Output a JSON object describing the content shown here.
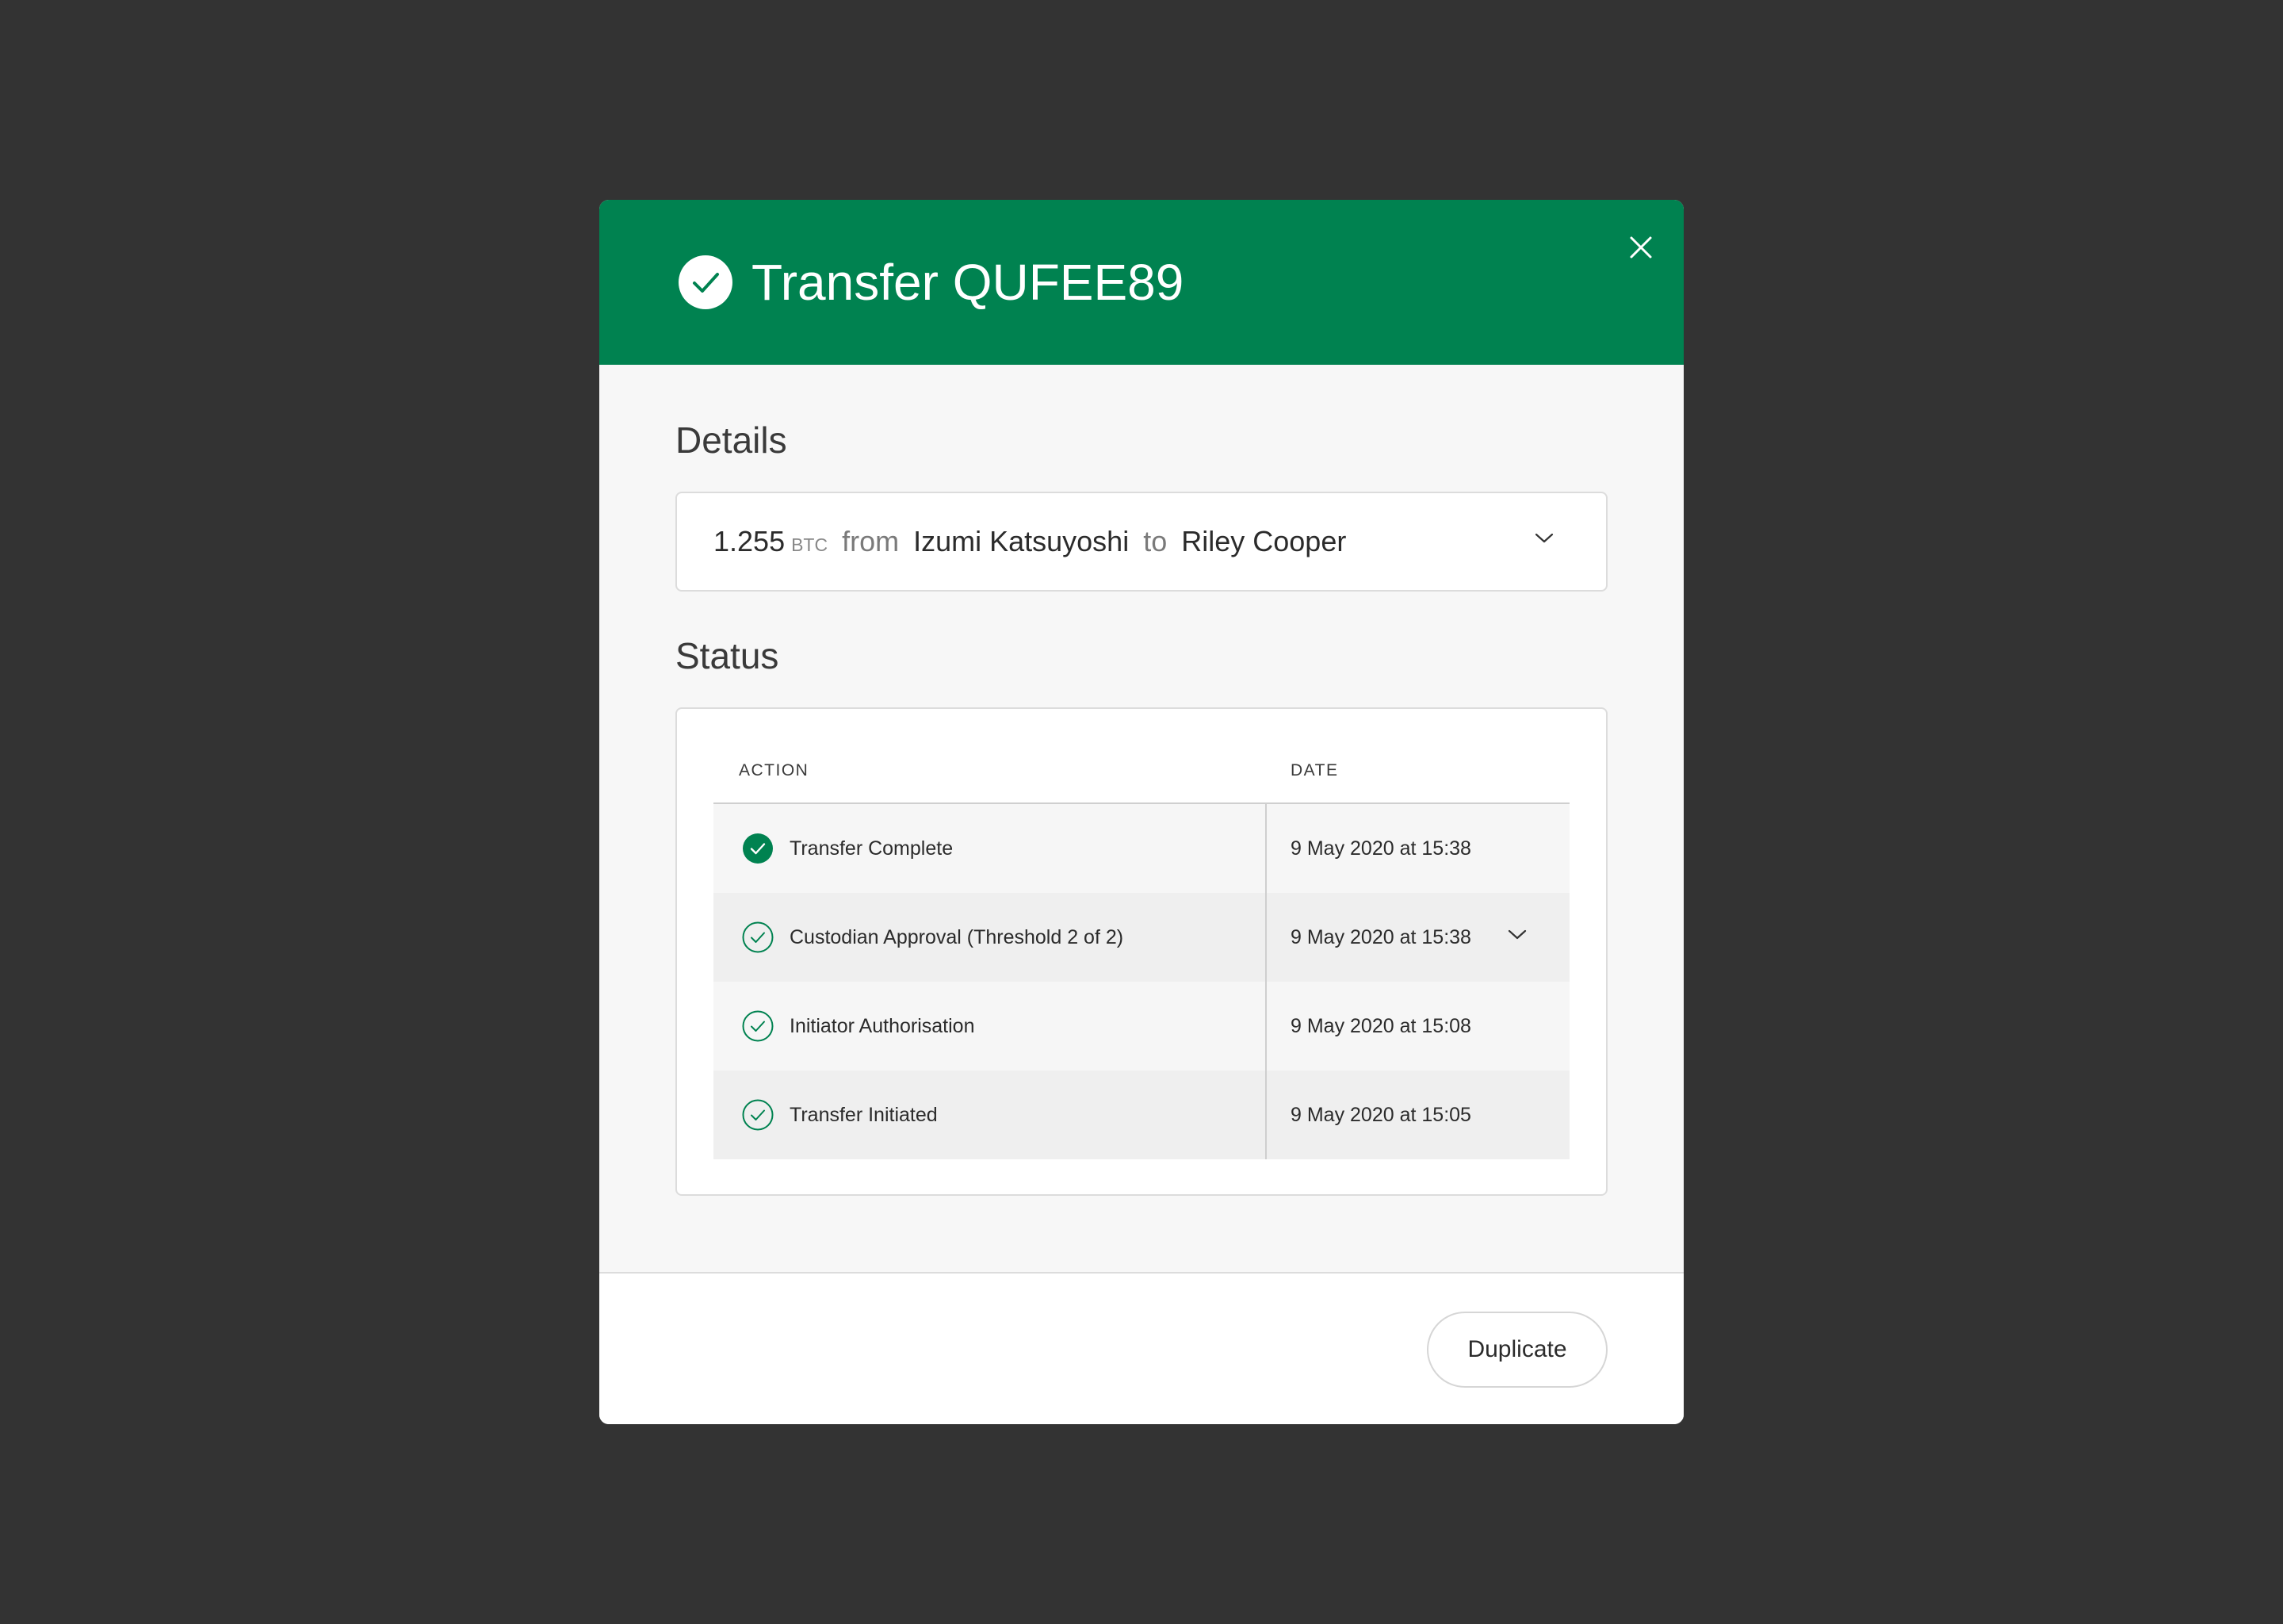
{
  "modal": {
    "title": "Transfer QUFEE89",
    "accent_color": "#008250",
    "header_icon": "check-circle-icon",
    "close_icon": "close-icon"
  },
  "details": {
    "section_title": "Details",
    "amount": "1.255",
    "unit": "BTC",
    "from_label": "from",
    "from_name": "Izumi Katsuyoshi",
    "to_label": "to",
    "to_name": "Riley Cooper",
    "expand_icon": "chevron-down-icon"
  },
  "status": {
    "section_title": "Status",
    "columns": [
      "ACTION",
      "DATE"
    ],
    "rows": [
      {
        "action": "Transfer Complete",
        "date": "9 May 2020 at 15:38",
        "icon": "check-circle-filled-icon",
        "expandable": false
      },
      {
        "action": "Custodian Approval (Threshold 2 of 2)",
        "date": "9 May 2020 at 15:38",
        "icon": "check-circle-outline-icon",
        "expandable": true
      },
      {
        "action": "Initiator Authorisation",
        "date": "9 May 2020 at 15:08",
        "icon": "check-circle-outline-icon",
        "expandable": false
      },
      {
        "action": "Transfer Initiated",
        "date": "9 May 2020 at 15:05",
        "icon": "check-circle-outline-icon",
        "expandable": false
      }
    ]
  },
  "footer": {
    "duplicate_label": "Duplicate"
  }
}
